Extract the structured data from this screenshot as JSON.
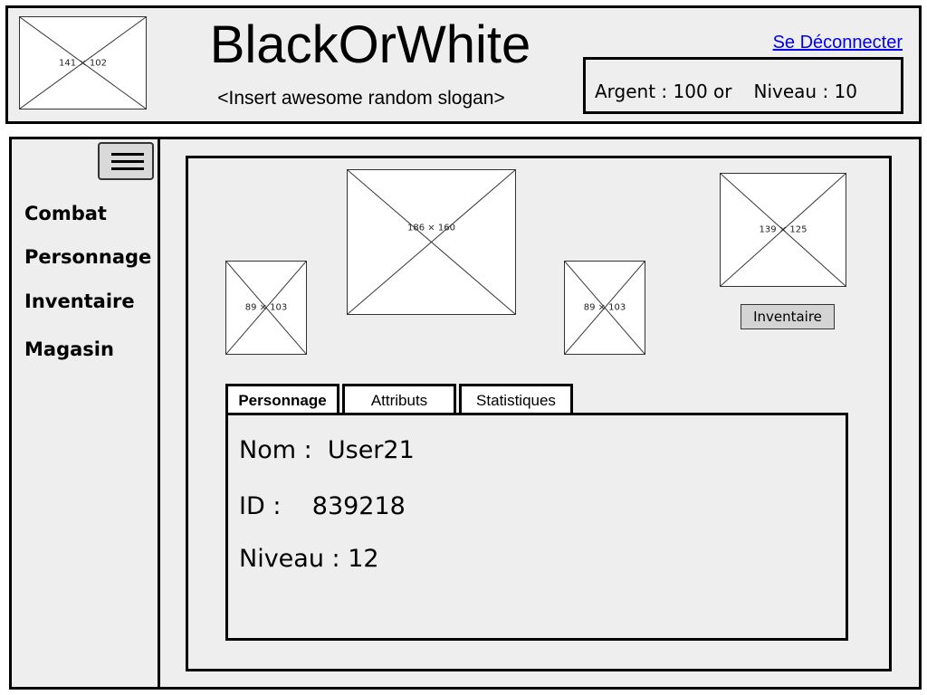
{
  "header": {
    "logo_placeholder": "141 × 102",
    "title": "BlackOrWhite",
    "slogan": "<Insert awesome random slogan>",
    "logout_label": "Se Déconnecter",
    "stats": {
      "money_label": "Argent : 100 or",
      "level_label": "Niveau : 10"
    }
  },
  "sidebar": {
    "menu_icon": "hamburger-menu-icon",
    "items": [
      {
        "label": "Combat"
      },
      {
        "label": "Personnage"
      },
      {
        "label": "Inventaire"
      },
      {
        "label": "Magasin"
      }
    ]
  },
  "content": {
    "images": [
      {
        "label": "89 × 103"
      },
      {
        "label": "186 × 160"
      },
      {
        "label": "89 × 103"
      },
      {
        "label": "139 × 125"
      }
    ],
    "inventory_button": "Inventaire",
    "tabs": [
      {
        "label": "Personnage",
        "active": true
      },
      {
        "label": "Attributs",
        "active": false
      },
      {
        "label": "Statistiques",
        "active": false
      }
    ],
    "character": {
      "name_line": "Nom :  User21",
      "id_line": "ID :    839218",
      "level_line": "Niveau : 12"
    }
  }
}
